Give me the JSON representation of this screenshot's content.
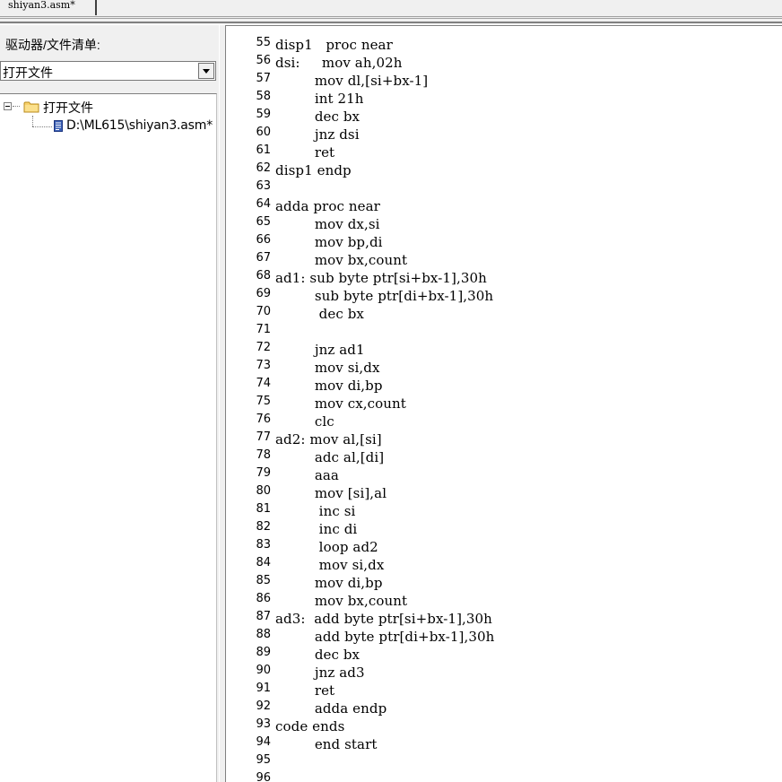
{
  "tabs": [
    {
      "label": "shiyan3.asm*"
    }
  ],
  "left_pane": {
    "drive_label": "驱动器/文件清单:",
    "combo_value": "打开文件",
    "tree": {
      "root_label": "打开文件",
      "child_label": "D:\\ML615\\shiyan3.asm*"
    }
  },
  "editor": {
    "lines": [
      {
        "num": "55",
        "text": "disp1   proc near"
      },
      {
        "num": "56",
        "text": "dsi:     mov ah,02h"
      },
      {
        "num": "57",
        "text": "         mov dl,[si+bx-1]"
      },
      {
        "num": "58",
        "text": "         int 21h"
      },
      {
        "num": "59",
        "text": "         dec bx"
      },
      {
        "num": "60",
        "text": "         jnz dsi"
      },
      {
        "num": "61",
        "text": "         ret"
      },
      {
        "num": "62",
        "text": "disp1 endp"
      },
      {
        "num": "63",
        "text": ""
      },
      {
        "num": "64",
        "text": "adda proc near"
      },
      {
        "num": "65",
        "text": "         mov dx,si"
      },
      {
        "num": "66",
        "text": "         mov bp,di"
      },
      {
        "num": "67",
        "text": "         mov bx,count"
      },
      {
        "num": "68",
        "text": "ad1: sub byte ptr[si+bx-1],30h"
      },
      {
        "num": "69",
        "text": "         sub byte ptr[di+bx-1],30h"
      },
      {
        "num": "70",
        "text": "          dec bx"
      },
      {
        "num": "71",
        "text": ""
      },
      {
        "num": "72",
        "text": "         jnz ad1"
      },
      {
        "num": "73",
        "text": "         mov si,dx"
      },
      {
        "num": "74",
        "text": "         mov di,bp"
      },
      {
        "num": "75",
        "text": "         mov cx,count"
      },
      {
        "num": "76",
        "text": "         clc"
      },
      {
        "num": "77",
        "text": "ad2: mov al,[si]"
      },
      {
        "num": "78",
        "text": "         adc al,[di]"
      },
      {
        "num": "79",
        "text": "         aaa"
      },
      {
        "num": "80",
        "text": "         mov [si],al"
      },
      {
        "num": "81",
        "text": "          inc si"
      },
      {
        "num": "82",
        "text": "          inc di"
      },
      {
        "num": "83",
        "text": "          loop ad2"
      },
      {
        "num": "84",
        "text": "          mov si,dx"
      },
      {
        "num": "85",
        "text": "         mov di,bp"
      },
      {
        "num": "86",
        "text": "         mov bx,count"
      },
      {
        "num": "87",
        "text": "ad3:  add byte ptr[si+bx-1],30h"
      },
      {
        "num": "88",
        "text": "         add byte ptr[di+bx-1],30h"
      },
      {
        "num": "89",
        "text": "         dec bx"
      },
      {
        "num": "90",
        "text": "         jnz ad3"
      },
      {
        "num": "91",
        "text": "         ret"
      },
      {
        "num": "92",
        "text": "         adda endp"
      },
      {
        "num": "93",
        "text": "code ends"
      },
      {
        "num": "94",
        "text": "         end start"
      },
      {
        "num": "95",
        "text": ""
      },
      {
        "num": "96",
        "text": ""
      }
    ]
  }
}
